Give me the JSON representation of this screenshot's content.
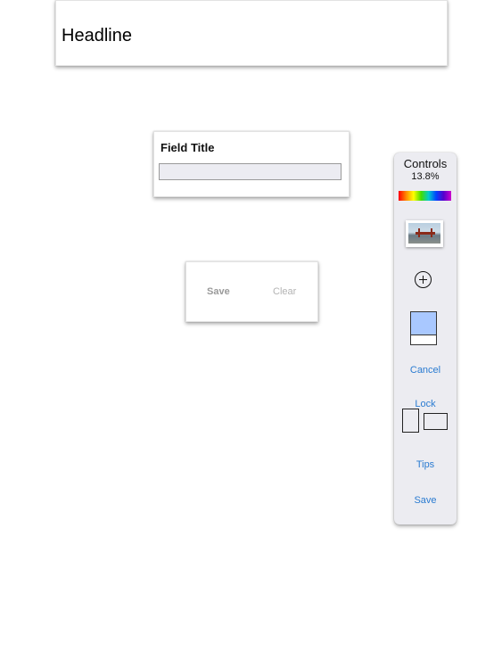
{
  "headline": {
    "title": "Headline"
  },
  "field": {
    "label": "Field Title",
    "value": "",
    "placeholder": ""
  },
  "actions": {
    "save_label": "Save",
    "clear_label": "Clear"
  },
  "controls": {
    "title": "Controls",
    "percent": "13.8%",
    "cancel_label": "Cancel",
    "lock_label": "Lock",
    "tips_label": "Tips",
    "save_label": "Save",
    "color_fill_fraction": 0.72,
    "accent_color": "#2a7bd1",
    "swatch_color": "#a9c8ff",
    "icons": [
      "spectrum-icon",
      "photo-thumbnail-icon",
      "add-circle-icon",
      "portrait-orientation-icon",
      "landscape-orientation-icon"
    ]
  }
}
